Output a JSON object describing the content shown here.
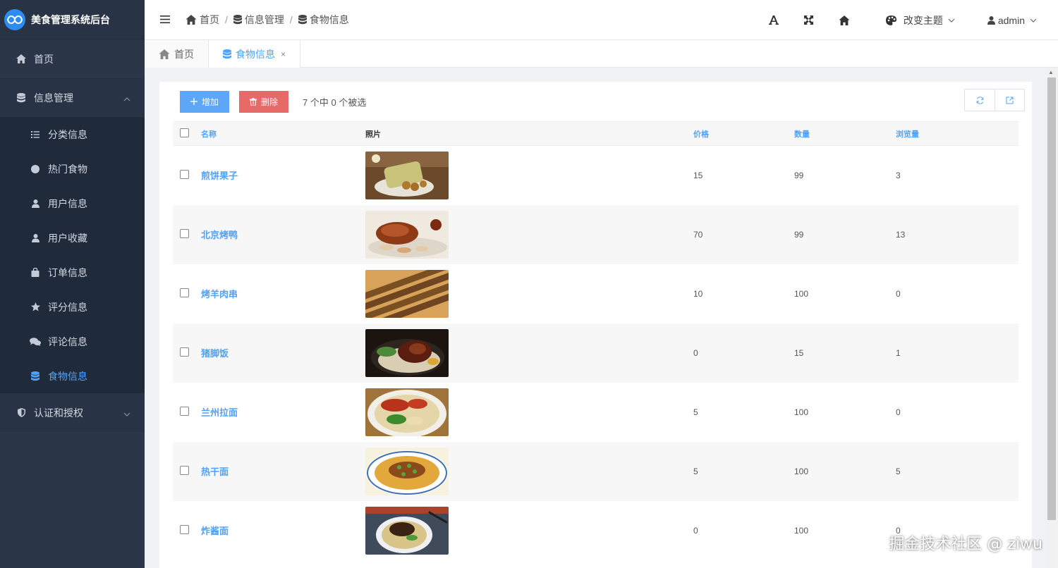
{
  "app": {
    "title": "美食管理系统后台"
  },
  "sidebar": {
    "home": {
      "label": "首页",
      "icon": "home-icon"
    },
    "group_info": {
      "label": "信息管理",
      "icon": "database-icon"
    },
    "items": [
      {
        "label": "分类信息",
        "icon": "list-icon"
      },
      {
        "label": "热门食物",
        "icon": "circle-icon"
      },
      {
        "label": "用户信息",
        "icon": "user-icon"
      },
      {
        "label": "用户收藏",
        "icon": "user-icon"
      },
      {
        "label": "订单信息",
        "icon": "bag-icon"
      },
      {
        "label": "评分信息",
        "icon": "star-icon"
      },
      {
        "label": "评论信息",
        "icon": "comments-icon"
      },
      {
        "label": "食物信息",
        "icon": "database-icon",
        "active": true
      }
    ],
    "group_auth": {
      "label": "认证和授权",
      "icon": "shield-icon"
    }
  },
  "topbar": {
    "breadcrumb": [
      "首页",
      "信息管理",
      "食物信息"
    ],
    "theme_label": "改变主题",
    "user_label": "admin"
  },
  "tabs": [
    {
      "label": "首页"
    },
    {
      "label": "食物信息",
      "close": "×"
    }
  ],
  "toolbar": {
    "add_label": "增加",
    "delete_label": "删除",
    "selection_info": "7 个中 0 个被选"
  },
  "table": {
    "headers": {
      "name": "名称",
      "photo": "照片",
      "price": "价格",
      "qty": "数量",
      "views": "浏览量"
    },
    "rows": [
      {
        "name": "煎饼果子",
        "price": "15",
        "qty": "99",
        "views": "3"
      },
      {
        "name": "北京烤鸭",
        "price": "70",
        "qty": "99",
        "views": "13"
      },
      {
        "name": "烤羊肉串",
        "price": "10",
        "qty": "100",
        "views": "0"
      },
      {
        "name": "猪脚饭",
        "price": "0",
        "qty": "15",
        "views": "1"
      },
      {
        "name": "兰州拉面",
        "price": "5",
        "qty": "100",
        "views": "0"
      },
      {
        "name": "热干面",
        "price": "5",
        "qty": "100",
        "views": "5"
      },
      {
        "name": "炸酱面",
        "price": "0",
        "qty": "100",
        "views": "0"
      }
    ]
  },
  "watermark": "掘金技术社区 @ ziwu",
  "colors": {
    "sidebar": "#2b3649",
    "accent": "#4ea3ff",
    "add": "#5ea7f8",
    "delete": "#e66a67"
  }
}
